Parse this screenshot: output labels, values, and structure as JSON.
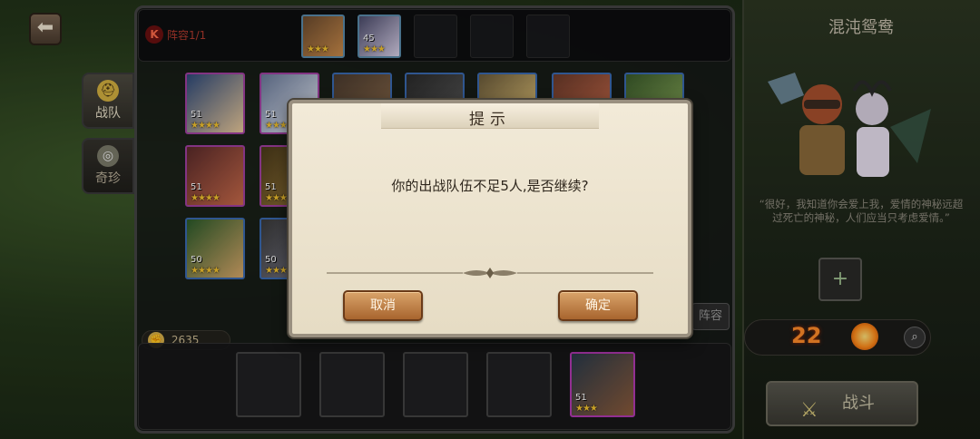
{
  "top": {
    "lineup_label": "阵容1/1",
    "lineup_icon": "K"
  },
  "team_slots_top": [
    {
      "level": "",
      "stars": "★★★",
      "colors": [
        "#6a4a2e",
        "#c98a4a"
      ]
    },
    {
      "level": "45",
      "stars": "★★★",
      "colors": [
        "#4a4a6a",
        "#d8d0e8"
      ]
    }
  ],
  "side_tabs": [
    {
      "label": "战队",
      "icon": "helmet-icon",
      "active": true
    },
    {
      "label": "奇珍",
      "icon": "swirl-icon",
      "active": false
    }
  ],
  "hero_grid": [
    {
      "level": "51",
      "stars": "★★★★",
      "colors": [
        "#2e4a7a",
        "#e8c89a"
      ]
    },
    {
      "level": "51",
      "stars": "★★★★",
      "colors": [
        "#6a7a9a",
        "#e8ecf4"
      ]
    },
    {
      "level": "",
      "stars": "",
      "colors": [
        "#4a3a2e",
        "#8a6a4a"
      ]
    },
    {
      "level": "",
      "stars": "",
      "colors": [
        "#2a2a2a",
        "#5a5a5a"
      ]
    },
    {
      "level": "",
      "stars": "",
      "colors": [
        "#6a5a3a",
        "#e8c87a"
      ]
    },
    {
      "level": "",
      "stars": "",
      "colors": [
        "#6a3a2a",
        "#c86a4a"
      ]
    },
    {
      "level": "",
      "stars": "",
      "colors": [
        "#3a5a2a",
        "#8aaa5a"
      ]
    },
    {
      "level": "51",
      "stars": "★★★★",
      "colors": [
        "#5a2a2a",
        "#c86a4a"
      ]
    },
    {
      "level": "51",
      "stars": "★★★★",
      "colors": [
        "#4a3a1a",
        "#9a7a3a"
      ]
    },
    {
      "level": "50",
      "stars": "★★★★",
      "colors": [
        "#2a5a2a",
        "#d8a86a"
      ]
    },
    {
      "level": "50",
      "stars": "★★★★",
      "colors": [
        "#3a3a3a",
        "#7a7a8a"
      ]
    }
  ],
  "power": {
    "icon": "fist-icon",
    "value": "2635"
  },
  "lineup_button": "阵容",
  "bottom_hero": {
    "level": "51",
    "stars": "★★★"
  },
  "right_panel": {
    "team_name": "混沌鸳鸯",
    "quote": "“很好，我知道你会爱上我，爱情的神秘远超过死亡的神秘，人们应当只考虑爱情。”",
    "add_label": "+",
    "stat_value": "22",
    "battle_label": "战斗"
  },
  "dialog": {
    "title": "提示",
    "message": "你的出战队伍不足5人,是否继续?",
    "cancel": "取消",
    "confirm": "确定"
  },
  "colors": {
    "dialog_bg": "#efe6d2",
    "button_orange": "#c0793e",
    "star": "#f4c430"
  }
}
